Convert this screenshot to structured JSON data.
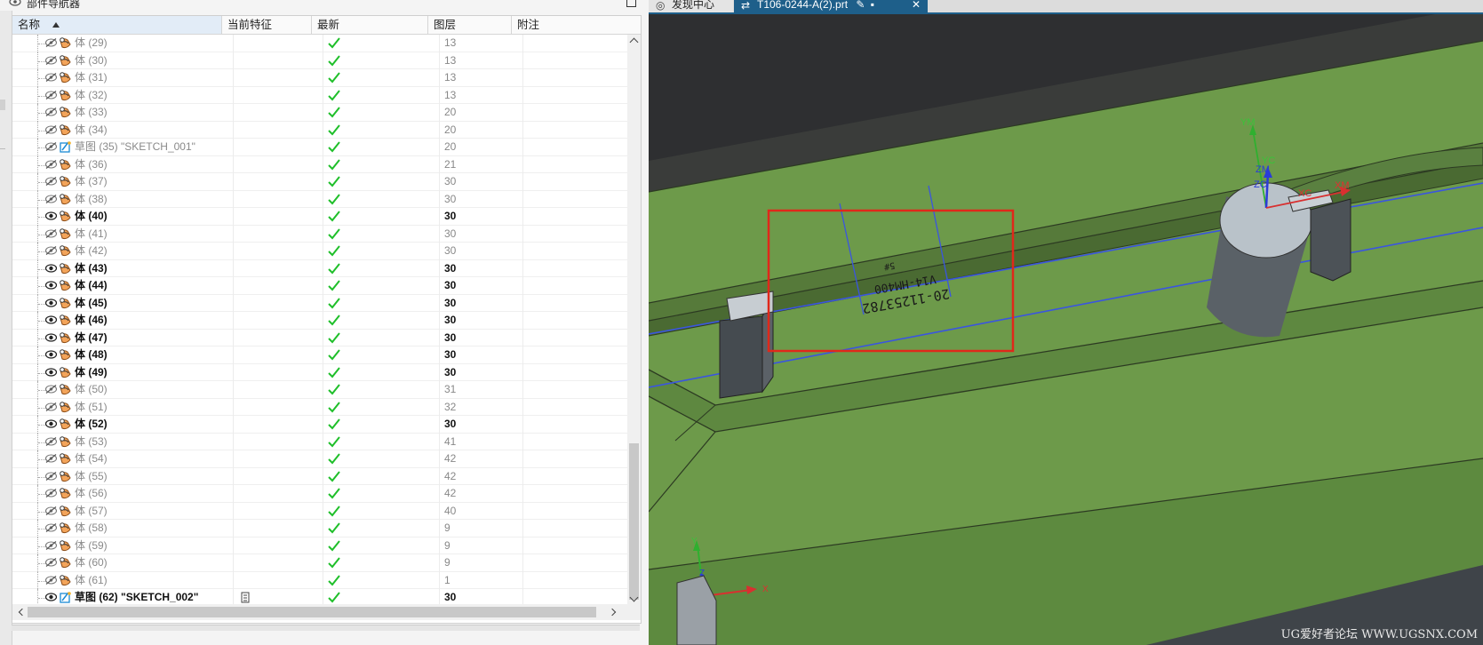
{
  "navigator": {
    "title": "部件导航器",
    "columns": {
      "name": "名称",
      "feature": "当前特征",
      "latest": "最新",
      "layer": "图层",
      "note": "附注"
    },
    "rows": [
      {
        "label": "体 (29)",
        "layer": "13",
        "visible": false,
        "type": "body"
      },
      {
        "label": "体 (30)",
        "layer": "13",
        "visible": false,
        "type": "body"
      },
      {
        "label": "体 (31)",
        "layer": "13",
        "visible": false,
        "type": "body"
      },
      {
        "label": "体 (32)",
        "layer": "13",
        "visible": false,
        "type": "body"
      },
      {
        "label": "体 (33)",
        "layer": "20",
        "visible": false,
        "type": "body"
      },
      {
        "label": "体 (34)",
        "layer": "20",
        "visible": false,
        "type": "body"
      },
      {
        "label": "草图 (35) \"SKETCH_001\"",
        "layer": "20",
        "visible": false,
        "type": "sketch"
      },
      {
        "label": "体 (36)",
        "layer": "21",
        "visible": false,
        "type": "body"
      },
      {
        "label": "体 (37)",
        "layer": "30",
        "visible": false,
        "type": "body"
      },
      {
        "label": "体 (38)",
        "layer": "30",
        "visible": false,
        "type": "body"
      },
      {
        "label": "体 (40)",
        "layer": "30",
        "visible": true,
        "type": "body"
      },
      {
        "label": "体 (41)",
        "layer": "30",
        "visible": false,
        "type": "body"
      },
      {
        "label": "体 (42)",
        "layer": "30",
        "visible": false,
        "type": "body"
      },
      {
        "label": "体 (43)",
        "layer": "30",
        "visible": true,
        "type": "body"
      },
      {
        "label": "体 (44)",
        "layer": "30",
        "visible": true,
        "type": "body"
      },
      {
        "label": "体 (45)",
        "layer": "30",
        "visible": true,
        "type": "body"
      },
      {
        "label": "体 (46)",
        "layer": "30",
        "visible": true,
        "type": "body"
      },
      {
        "label": "体 (47)",
        "layer": "30",
        "visible": true,
        "type": "body"
      },
      {
        "label": "体 (48)",
        "layer": "30",
        "visible": true,
        "type": "body"
      },
      {
        "label": "体 (49)",
        "layer": "30",
        "visible": true,
        "type": "body"
      },
      {
        "label": "体 (50)",
        "layer": "31",
        "visible": false,
        "type": "body"
      },
      {
        "label": "体 (51)",
        "layer": "32",
        "visible": false,
        "type": "body"
      },
      {
        "label": "体 (52)",
        "layer": "30",
        "visible": true,
        "type": "body"
      },
      {
        "label": "体 (53)",
        "layer": "41",
        "visible": false,
        "type": "body"
      },
      {
        "label": "体 (54)",
        "layer": "42",
        "visible": false,
        "type": "body"
      },
      {
        "label": "体 (55)",
        "layer": "42",
        "visible": false,
        "type": "body"
      },
      {
        "label": "体 (56)",
        "layer": "42",
        "visible": false,
        "type": "body"
      },
      {
        "label": "体 (57)",
        "layer": "40",
        "visible": false,
        "type": "body"
      },
      {
        "label": "体 (58)",
        "layer": "9",
        "visible": false,
        "type": "body"
      },
      {
        "label": "体 (59)",
        "layer": "9",
        "visible": false,
        "type": "body"
      },
      {
        "label": "体 (60)",
        "layer": "9",
        "visible": false,
        "type": "body"
      },
      {
        "label": "体 (61)",
        "layer": "1",
        "visible": false,
        "type": "body"
      },
      {
        "label": "草图 (62) \"SKETCH_002\"",
        "layer": "30",
        "visible": true,
        "type": "sketch",
        "current_feature": true
      }
    ]
  },
  "graphics": {
    "tabs": [
      {
        "label": "发现中心",
        "active": false
      },
      {
        "label": "T106-0244-A(2).prt",
        "active": true
      }
    ],
    "engraving": {
      "line1": "20-11253782",
      "line2": "V14-HM400",
      "line3": "5#"
    },
    "axes": {
      "ym": "YM",
      "yc": "YC",
      "zm": "ZM",
      "zc": "ZC",
      "xc": "XC",
      "xm": "XM",
      "y": "Y",
      "z": "Z",
      "x": "X"
    },
    "watermark": "UG爱好者论坛 WWW.UGSNX.COM",
    "colors": {
      "part_green": "#6d9a4a",
      "selection_box": "#e0281a",
      "sketch_line": "#3a55e0"
    }
  }
}
